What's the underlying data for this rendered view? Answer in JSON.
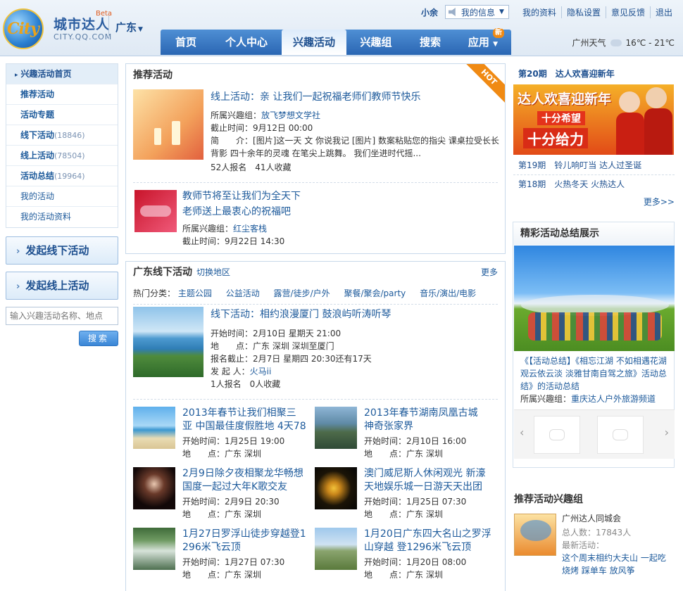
{
  "header": {
    "logo_cn": "城市达人",
    "logo_beta": "Beta",
    "logo_url": "CITY.QQ.COM",
    "logo_word": "City",
    "region": "广东",
    "user": "小余",
    "my_info": "我的信息",
    "links": [
      "我的资料",
      "隐私设置",
      "意见反馈",
      "退出"
    ],
    "nav": [
      "首页",
      "个人中心",
      "兴趣活动",
      "兴趣组",
      "搜索",
      "应用"
    ],
    "nav_new_badge": "新",
    "weather_city": "广州天气",
    "weather_temp": "16℃ - 21℃"
  },
  "sidebar": {
    "items": [
      {
        "label": "兴趣活动首页",
        "count": ""
      },
      {
        "label": "推荐活动",
        "count": ""
      },
      {
        "label": "活动专题",
        "count": ""
      },
      {
        "label": "线下活动",
        "count": "(18846)"
      },
      {
        "label": "线上活动",
        "count": "(78504)"
      },
      {
        "label": "活动总结",
        "count": "(19964)"
      },
      {
        "label": "我的活动",
        "count": ""
      },
      {
        "label": "我的活动资料",
        "count": ""
      }
    ],
    "btn_offline": "发起线下活动",
    "btn_online": "发起线上活动",
    "search_placeholder": "输入兴趣活动名称、地点",
    "search_btn": "搜索"
  },
  "recommended": {
    "title": "推荐活动",
    "hot": "HOT",
    "ev1": {
      "title": "线上活动：亲 让我们一起祝福老师们教师节快乐",
      "group_label": "所属兴趣组：",
      "group": "放飞梦想文学社",
      "deadline": "截止时间：9月12日 00:00",
      "desc_label": "简　　介：",
      "desc": "[图片]这一天 文 你说我记 [图片] 数案粘贴您的指尖 课桌拉受长长背影 四十余年的灵魂 在笔尖上跳舞。 我们坐进时代摇...",
      "stats": "52人报名　41人收藏"
    },
    "ev2": {
      "title1": "教师节将至让我们为全天下",
      "title2": "老师送上最衷心的祝福吧",
      "group_label": "所属兴趣组：",
      "group": "红尘客栈",
      "deadline": "截止时间：9月22日 14:30"
    }
  },
  "local": {
    "title": "广东线下活动",
    "switch": "切换地区",
    "more": "更多",
    "hot_label": "热门分类：",
    "cats": [
      "主题公园",
      "公益活动",
      "露营/徒步/户外",
      "聚餐/聚会/party",
      "音乐/演出/电影"
    ],
    "feature": {
      "title": "线下活动：相约浪漫厦门 鼓浪屿听涛听琴",
      "start": "开始时间：2月10日 星期天 21:00",
      "place": "地　　点：广东 深圳 深圳至厦门",
      "deadline": "报名截止：2月7日 星期四 20:30还有17天",
      "sponsor_label": "发 起 人：",
      "sponsor": "火马ii",
      "stats": "1人报名　0人收藏"
    },
    "grid": [
      {
        "t1": "2013年春节让我们相聚三",
        "t2": "亚 中国最佳度假胜地 4天78",
        "start": "开始时间：1月25日 19:00",
        "place": "地　　点：广东 深圳"
      },
      {
        "t1": "2013年春节湖南凤凰古城",
        "t2": "神奇张家界",
        "start": "开始时间：2月10日 16:00",
        "place": "地　　点：广东 深圳"
      },
      {
        "t1": "2月9日除夕夜相聚龙华畅想",
        "t2": "国度一起过大年K歌交友",
        "start": "开始时间：2月9日 20:30",
        "place": "地　　点：广东 深圳"
      },
      {
        "t1": "澳门威尼斯人休闲观光 新濠",
        "t2": "天地娱乐城一日游天天出团",
        "start": "开始时间：1月25日 07:30",
        "place": "地　　点：广东 深圳"
      },
      {
        "t1": "1月27日罗浮山徒步穿越登1",
        "t2": "296米飞云顶",
        "start": "开始时间：1月27日 07:30",
        "place": "地　　点：广东 深圳"
      },
      {
        "t1": "1月20日广东四大名山之罗浮",
        "t2": "山穿越 登1296米飞云顶",
        "start": "开始时间：1月20日 08:00",
        "place": "地　　点：广东 深圳"
      }
    ]
  },
  "right": {
    "issue_title": "第20期　达人欢喜迎新年",
    "banner_line1": "达人欢喜迎新年",
    "banner_line2": "十分希望",
    "banner_line3": "十分给力",
    "issue19": "第19期　铃儿响叮当 达人过圣诞",
    "issue18": "第18期　火热冬天 火热达人",
    "more": "更多>>",
    "summary_title": "精彩活动总结展示",
    "summary_text": "《【活动总结】《相忘江湖 不如相遇花湖 观云依云淡 淡雅甘南自驾之旅》活动总结》的活动总结",
    "summary_group_label": "所属兴趣组：",
    "summary_group": "重庆达人户外旅游频道",
    "recgroup_title": "推荐活动兴趣组",
    "recgroup_name": "广州达人同城会",
    "recgroup_members": "总人数：17843人",
    "recgroup_latest_label": "最新活动：",
    "recgroup_latest1": "这个周末相约大夫山 一起吃",
    "recgroup_latest2": "烧烤 踩单车 放风筝"
  },
  "colors": {
    "nav_blue": "#2a66b3",
    "link_blue": "#1d5a9b",
    "hot_orange": "#f08a13"
  }
}
